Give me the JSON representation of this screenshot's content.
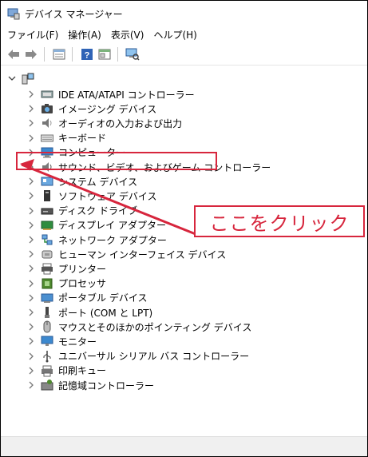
{
  "window": {
    "title": "デバイス マネージャー"
  },
  "menu": [
    {
      "label": "ファイル(F)"
    },
    {
      "label": "操作(A)"
    },
    {
      "label": "表示(V)"
    },
    {
      "label": "ヘルプ(H)"
    }
  ],
  "toolbar": [
    {
      "icon": "back-arrow-icon"
    },
    {
      "icon": "forward-arrow-icon"
    },
    {
      "icon": "properties-icon"
    },
    {
      "icon": "help-icon"
    },
    {
      "icon": "update-driver-icon"
    },
    {
      "icon": "scan-hardware-icon"
    }
  ],
  "tree": {
    "root_label": "",
    "items": [
      {
        "label": "IDE ATA/ATAPI コントローラー",
        "icon": "ide-controller-icon"
      },
      {
        "label": "イメージング デバイス",
        "icon": "camera-icon"
      },
      {
        "label": "オーディオの入力および出力",
        "icon": "speaker-icon"
      },
      {
        "label": "キーボード",
        "icon": "keyboard-icon"
      },
      {
        "label": "コンピューター",
        "icon": "computer-icon"
      },
      {
        "label": "サウンド、ビデオ、およびゲーム コントローラー",
        "icon": "sound-icon"
      },
      {
        "label": "システム デバイス",
        "icon": "system-device-icon"
      },
      {
        "label": "ソフトウェア デバイス",
        "icon": "software-device-icon"
      },
      {
        "label": "ディスク ドライブ",
        "icon": "disk-drive-icon"
      },
      {
        "label": "ディスプレイ アダプター",
        "icon": "display-adapter-icon"
      },
      {
        "label": "ネットワーク アダプター",
        "icon": "network-adapter-icon"
      },
      {
        "label": "ヒューマン インターフェイス デバイス",
        "icon": "hid-icon"
      },
      {
        "label": "プリンター",
        "icon": "printer-icon"
      },
      {
        "label": "プロセッサ",
        "icon": "processor-icon"
      },
      {
        "label": "ポータブル デバイス",
        "icon": "portable-device-icon"
      },
      {
        "label": "ポート (COM と LPT)",
        "icon": "port-icon"
      },
      {
        "label": "マウスとそのほかのポインティング デバイス",
        "icon": "mouse-icon"
      },
      {
        "label": "モニター",
        "icon": "monitor-icon"
      },
      {
        "label": "ユニバーサル シリアル バス コントローラー",
        "icon": "usb-icon"
      },
      {
        "label": "印刷キュー",
        "icon": "print-queue-icon"
      },
      {
        "label": "記憶域コントローラー",
        "icon": "storage-controller-icon"
      }
    ]
  },
  "annotation": {
    "text": "ここをクリック",
    "color": "#d7263d",
    "target_label": "サウンド、ビデオ、およびゲーム コントローラー"
  }
}
